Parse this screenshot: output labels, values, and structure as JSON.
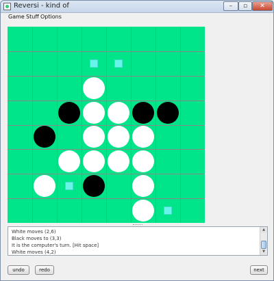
{
  "window": {
    "title": "Reversi - kind of",
    "min_glyph": "–",
    "max_glyph": "▫",
    "close_glyph": "✕"
  },
  "menu": {
    "items": [
      "Game",
      "Stuff",
      "Options"
    ]
  },
  "board": {
    "rows": 8,
    "cols": 8,
    "background_color": "#00e58a",
    "white_discs": [
      [
        2,
        3
      ],
      [
        3,
        3
      ],
      [
        3,
        4
      ],
      [
        4,
        3
      ],
      [
        4,
        4
      ],
      [
        4,
        5
      ],
      [
        5,
        2
      ],
      [
        5,
        3
      ],
      [
        5,
        4
      ],
      [
        5,
        5
      ],
      [
        6,
        1
      ],
      [
        6,
        5
      ],
      [
        7,
        5
      ]
    ],
    "black_discs": [
      [
        3,
        2
      ],
      [
        3,
        5
      ],
      [
        3,
        6
      ],
      [
        4,
        1
      ],
      [
        6,
        3
      ]
    ],
    "hint_squares": [
      [
        1,
        3
      ],
      [
        1,
        4
      ],
      [
        6,
        2
      ],
      [
        7,
        6
      ],
      [
        8,
        5
      ]
    ]
  },
  "log": {
    "lines": [
      "White moves (2,6)",
      "Black moves to (3,3)",
      "It is the computer's turn. [Hit space]",
      "White moves (4,2)"
    ]
  },
  "buttons": {
    "undo": "undo",
    "redo": "redo",
    "next": "next"
  }
}
